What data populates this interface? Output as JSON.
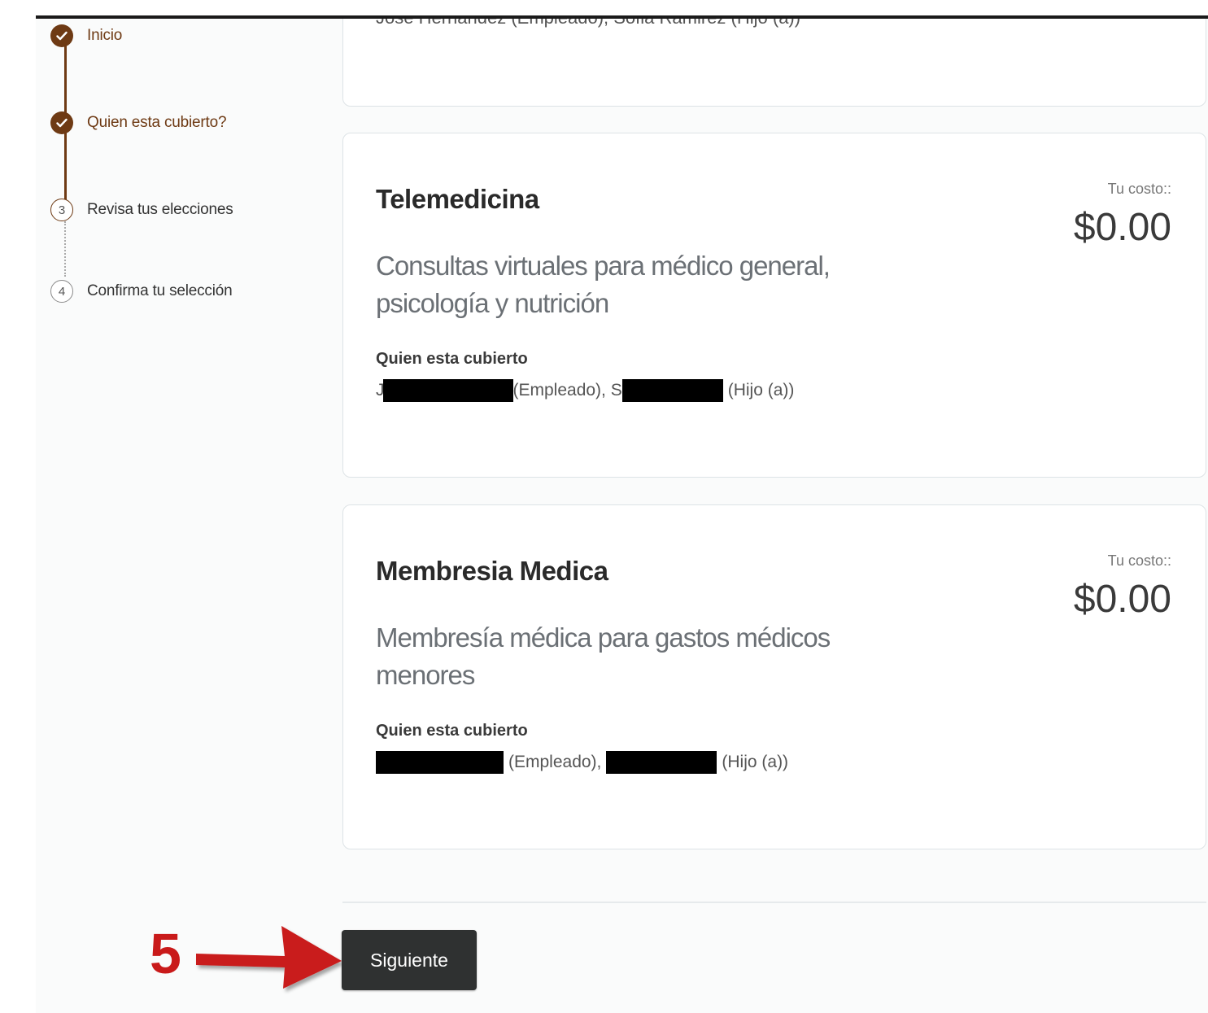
{
  "stepper": {
    "steps": [
      {
        "label": "Inicio",
        "state": "done"
      },
      {
        "label": "Quien esta cubierto?",
        "state": "done"
      },
      {
        "label": "Revisa tus elecciones",
        "state": "current",
        "number": "3"
      },
      {
        "label": "Confirma tu selección",
        "state": "pending",
        "number": "4"
      }
    ]
  },
  "cards": {
    "partial": {
      "coverage_text": "Jose Hernandez (Empleado), Sofia Ramirez (Hijo (a))"
    },
    "telemedicina": {
      "title": "Telemedicina",
      "description": "Consultas virtuales para médico general, psicología y nutrición",
      "cost_label": "Tu costo::",
      "cost_value": "$0.00",
      "covered_heading": "Quien esta cubierto",
      "member1_prefix": "J",
      "member1_role": "(Empleado), S",
      "member2_role": "(Hijo (a))"
    },
    "membresia": {
      "title": "Membresia Medica",
      "description": "Membresía médica para gastos médicos menores",
      "cost_label": "Tu costo::",
      "cost_value": "$0.00",
      "covered_heading": "Quien esta cubierto",
      "member1_role": "(Empleado),",
      "member2_role": "(Hijo (a))"
    }
  },
  "actions": {
    "next_label": "Siguiente"
  },
  "annotation": {
    "step_number": "5",
    "color": "#c91a1a"
  },
  "colors": {
    "brand": "#6e3a14",
    "button": "#2f3131"
  }
}
